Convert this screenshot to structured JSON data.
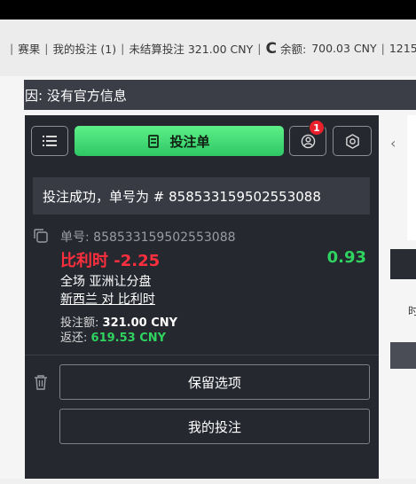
{
  "infobar": {
    "items": [
      "赛果",
      "我的投注 (1)",
      "未结算投注 321.00 CNY"
    ],
    "balance_label": "余额:",
    "balance_value": "700.03 CNY",
    "trailing": "1215"
  },
  "notice": {
    "text": "因: 没有官方信息"
  },
  "betslip": {
    "slip_label": "投注单",
    "badge_count": "1",
    "success_text": "投注成功，单号为 # 858533159502553088",
    "bet": {
      "number_label": "单号:",
      "number": "858533159502553088",
      "selection": "比利时 -2.25",
      "odds": "0.93",
      "market": "全场 亚洲让分盘",
      "match": "新西兰 对 比利时",
      "stake_label": "投注额:",
      "stake_value": "321.00 CNY",
      "return_label": "返还:",
      "return_value": "619.53 CNY"
    },
    "keep_button": "保留选项",
    "mybets_button": "我的投注"
  },
  "right": {
    "fragment": "时"
  },
  "colors": {
    "panel_bg": "#262830",
    "accent_green": "#2fd35f",
    "selection_red": "#ff2f3d",
    "badge_red": "#e8212c"
  },
  "icons": [
    "list-icon",
    "betslip-icon",
    "user-icon",
    "gear-icon",
    "copy-icon",
    "trash-icon",
    "refresh-icon",
    "chevron-left-icon"
  ]
}
